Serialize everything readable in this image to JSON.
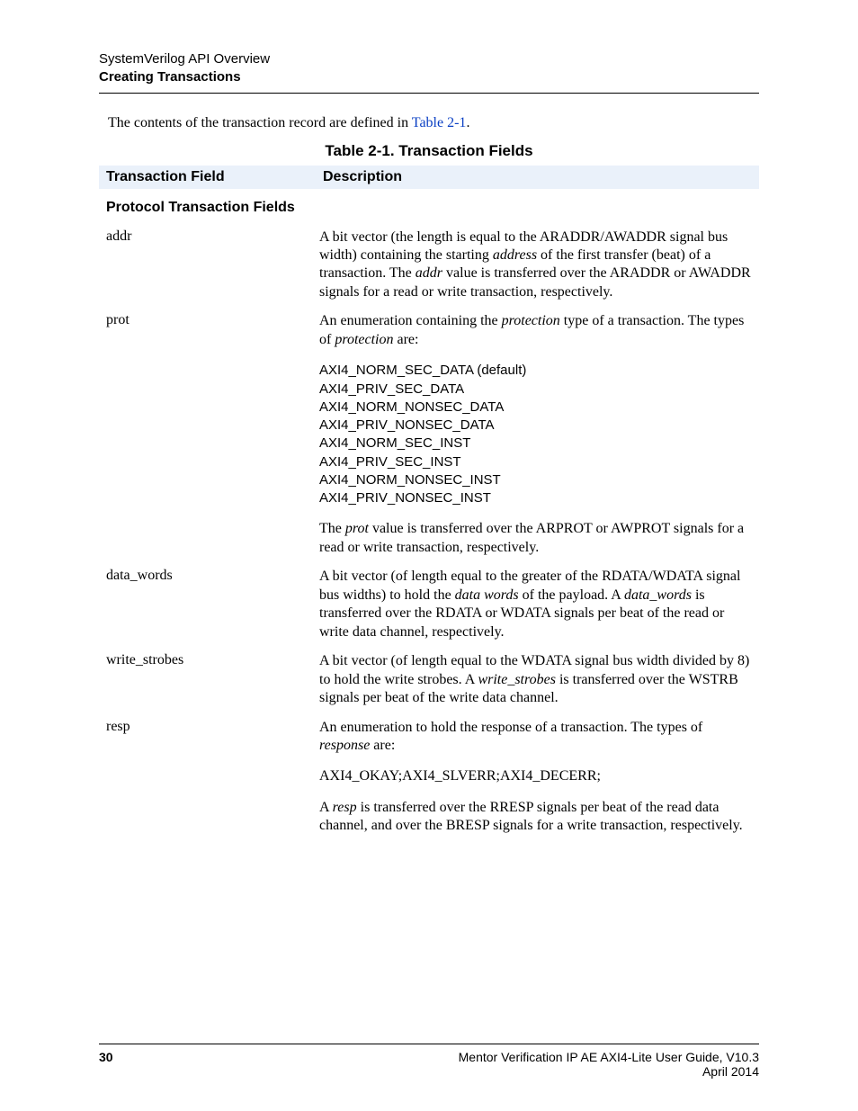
{
  "header": {
    "line1": "SystemVerilog API Overview",
    "line2": "Creating Transactions"
  },
  "intro": {
    "prefix": "The contents of the transaction record are defined in ",
    "xref": "Table 2-1",
    "suffix": "."
  },
  "table": {
    "title": "Table 2-1. Transaction Fields",
    "col1": "Transaction Field",
    "col2": "Description",
    "section": "Protocol Transaction Fields",
    "rows": {
      "addr": {
        "name": "addr",
        "desc_html": "A bit vector (the length is equal to the ARADDR/AWADDR signal bus width) containing the starting <em>address</em> of the first transfer (beat) of a transaction. The <em>addr</em> value is transferred over the ARADDR or AWADDR signals for a read or write transaction, respectively."
      },
      "prot": {
        "name": "prot",
        "lead_html": "An enumeration containing the <em>protection</em> type of a transaction. The types of <em>protection</em> are:",
        "enums": [
          "AXI4_NORM_SEC_DATA (default)",
          "AXI4_PRIV_SEC_DATA",
          "AXI4_NORM_NONSEC_DATA",
          "AXI4_PRIV_NONSEC_DATA",
          "AXI4_NORM_SEC_INST",
          "AXI4_PRIV_SEC_INST",
          "AXI4_NORM_NONSEC_INST",
          "AXI4_PRIV_NONSEC_INST"
        ],
        "trail_html": "The <em>prot</em> value is transferred over the ARPROT or AWPROT signals for a read or write transaction, respectively."
      },
      "data_words": {
        "name": "data_words",
        "desc_html": "A bit vector (of length equal to the greater of the RDATA/WDATA signal bus widths) to hold the <em>data words</em> of the payload. A <em>data_words</em> is transferred over the RDATA or WDATA signals per beat of the read or write data channel, respectively."
      },
      "write_strobes": {
        "name": "write_strobes",
        "desc_html": "A bit vector (of length equal to the WDATA signal bus width divided by 8) to hold the write strobes. A <em>write_strobes</em> is transferred over the WSTRB signals per beat of the write data channel."
      },
      "resp": {
        "name": "resp",
        "lead_html": "An enumeration to hold the response of a transaction. The types of <em>response</em> are:",
        "enums": [
          "AXI4_OKAY;",
          "AXI4_SLVERR;",
          "AXI4_DECERR;"
        ],
        "trail_html": "A <em>resp</em> is transferred over the RRESP signals per beat of the read data channel, and over the BRESP signals for a write transaction, respectively."
      }
    }
  },
  "footer": {
    "page": "30",
    "doc": "Mentor Verification IP AE AXI4-Lite User Guide, V10.3",
    "date": "April 2014"
  }
}
